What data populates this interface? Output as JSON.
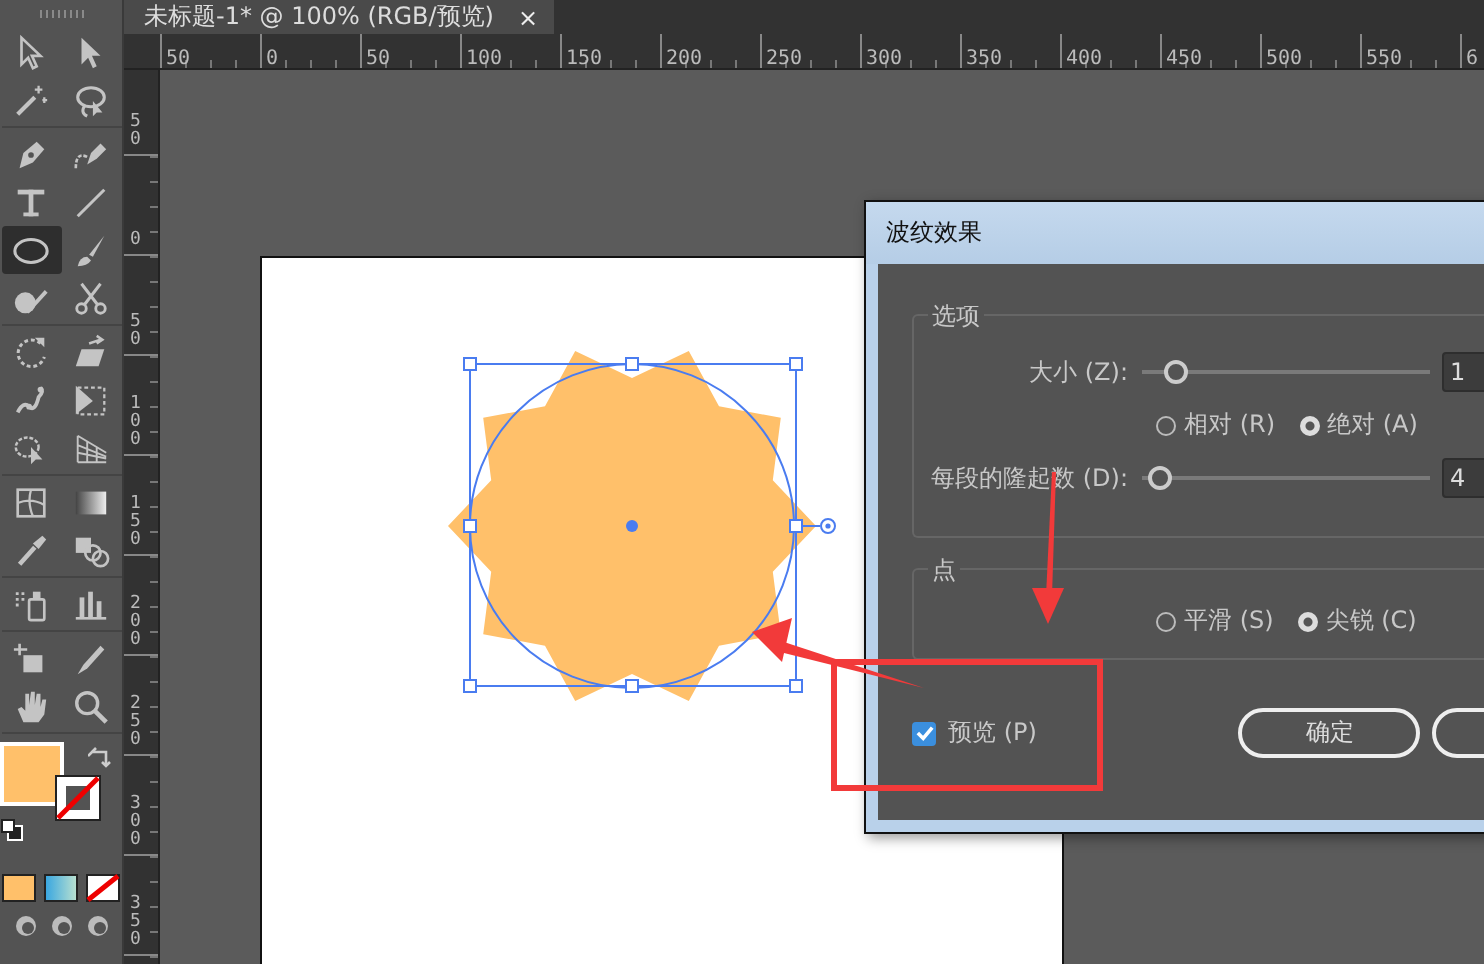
{
  "tab": {
    "title": "未标题-1* @ 100% (RGB/预览)",
    "close": "×"
  },
  "rulers": {
    "horizontal": [
      "50",
      "0",
      "50",
      "100",
      "150",
      "200",
      "250",
      "300",
      "350",
      "400",
      "450",
      "500",
      "550",
      "6"
    ],
    "vertical": [
      "50",
      "0",
      "50",
      "100",
      "150",
      "200",
      "250",
      "300",
      "350"
    ]
  },
  "tool_groups": [
    {
      "tools": [
        {
          "kind": "selection",
          "selected": false
        },
        {
          "kind": "direct-selection",
          "selected": false
        },
        {
          "kind": "magic-wand",
          "selected": false
        },
        {
          "kind": "lasso",
          "selected": false
        }
      ]
    },
    {
      "tools": [
        {
          "kind": "pen",
          "selected": false
        },
        {
          "kind": "curvature",
          "selected": false
        },
        {
          "kind": "type",
          "selected": false
        },
        {
          "kind": "line",
          "selected": false
        },
        {
          "kind": "ellipse",
          "selected": true
        },
        {
          "kind": "paintbrush",
          "selected": false
        },
        {
          "kind": "shaper",
          "selected": false
        },
        {
          "kind": "scissors",
          "selected": false
        }
      ]
    },
    {
      "tools": [
        {
          "kind": "rotate",
          "selected": false
        },
        {
          "kind": "scale",
          "selected": false
        },
        {
          "kind": "puppet-warp",
          "selected": false
        },
        {
          "kind": "free-transform",
          "selected": false
        },
        {
          "kind": "shape-builder",
          "selected": false
        },
        {
          "kind": "perspective-grid",
          "selected": false
        }
      ]
    },
    {
      "tools": [
        {
          "kind": "mesh",
          "selected": false
        },
        {
          "kind": "gradient",
          "selected": false
        },
        {
          "kind": "eyedropper",
          "selected": false
        },
        {
          "kind": "blend",
          "selected": false
        }
      ]
    },
    {
      "tools": [
        {
          "kind": "symbol-sprayer",
          "selected": false
        },
        {
          "kind": "column-graph",
          "selected": false
        }
      ]
    },
    {
      "tools": [
        {
          "kind": "artboard",
          "selected": false
        },
        {
          "kind": "slice",
          "selected": false
        },
        {
          "kind": "hand",
          "selected": false
        },
        {
          "kind": "zoom",
          "selected": false
        }
      ]
    }
  ],
  "dialog": {
    "title": "波纹效果",
    "options": {
      "label": "选项",
      "size": {
        "label": "大小 (Z):",
        "level": 0.12,
        "value": "1"
      },
      "mode": [
        {
          "label": "相对 (R)",
          "selected": false
        },
        {
          "label": "绝对 (A)",
          "selected": true
        }
      ],
      "ridges": {
        "label": "每段的隆起数 (D):",
        "level": 0.06,
        "value": "4"
      }
    },
    "points": {
      "label": "点",
      "choices": [
        {
          "label": "平滑 (S)",
          "selected": false
        },
        {
          "label": "尖锐 (C)",
          "selected": true
        }
      ]
    },
    "preview": {
      "label": "预览 (P)",
      "checked": true
    },
    "buttons": [
      {
        "label": "确定"
      }
    ]
  }
}
